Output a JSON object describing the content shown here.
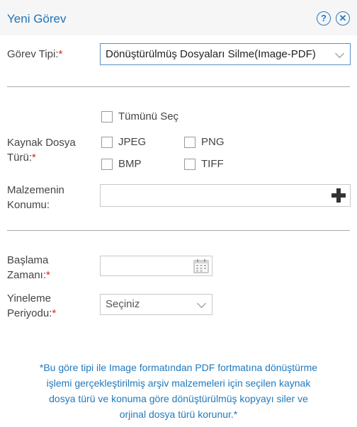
{
  "dialog": {
    "title": "Yeni Görev"
  },
  "header_icons": {
    "help": "help-circle-icon",
    "close": "close-circle-icon"
  },
  "task_type": {
    "label": "Görev Tipi:",
    "required_mark": "*",
    "selected_value": "Dönüştürülmüş Dosyaları Silme(Image-PDF)"
  },
  "source_file_type": {
    "label_line1": "Kaynak Dosya",
    "label_line2": "Türü:",
    "required_mark": "*",
    "select_all": "Tümünü Seç",
    "options": [
      "JPEG",
      "PNG",
      "BMP",
      "TIFF"
    ]
  },
  "material_location": {
    "label_line1": "Malzemenin",
    "label_line2": "Konumu:",
    "value": "",
    "add_icon": "plus-icon"
  },
  "start_time": {
    "label_line1": "Başlama",
    "label_line2": "Zamanı:",
    "required_mark": "*",
    "value": "",
    "calendar_icon": "calendar-icon"
  },
  "repeat_period": {
    "label_line1": "Yineleme",
    "label_line2": "Periyodu:",
    "required_mark": "*",
    "selected_value": "Seçiniz"
  },
  "info_note": {
    "line1": "*Bu göre tipi ile Image formatından PDF fortmatına dönüştürme",
    "line2": "işlemi gerçekleştirilmiş arşiv malzemeleri için seçilen kaynak",
    "line3": "dosya türü ve konuma göre dönüştürülmüş kopyayı siler ve",
    "line4": "orjinal dosya türü korunur.*"
  },
  "colors": {
    "accent": "#1e73b8",
    "required": "#d9261c",
    "note_text": "#1f79bd",
    "header_bg": "#f6f6f6"
  }
}
